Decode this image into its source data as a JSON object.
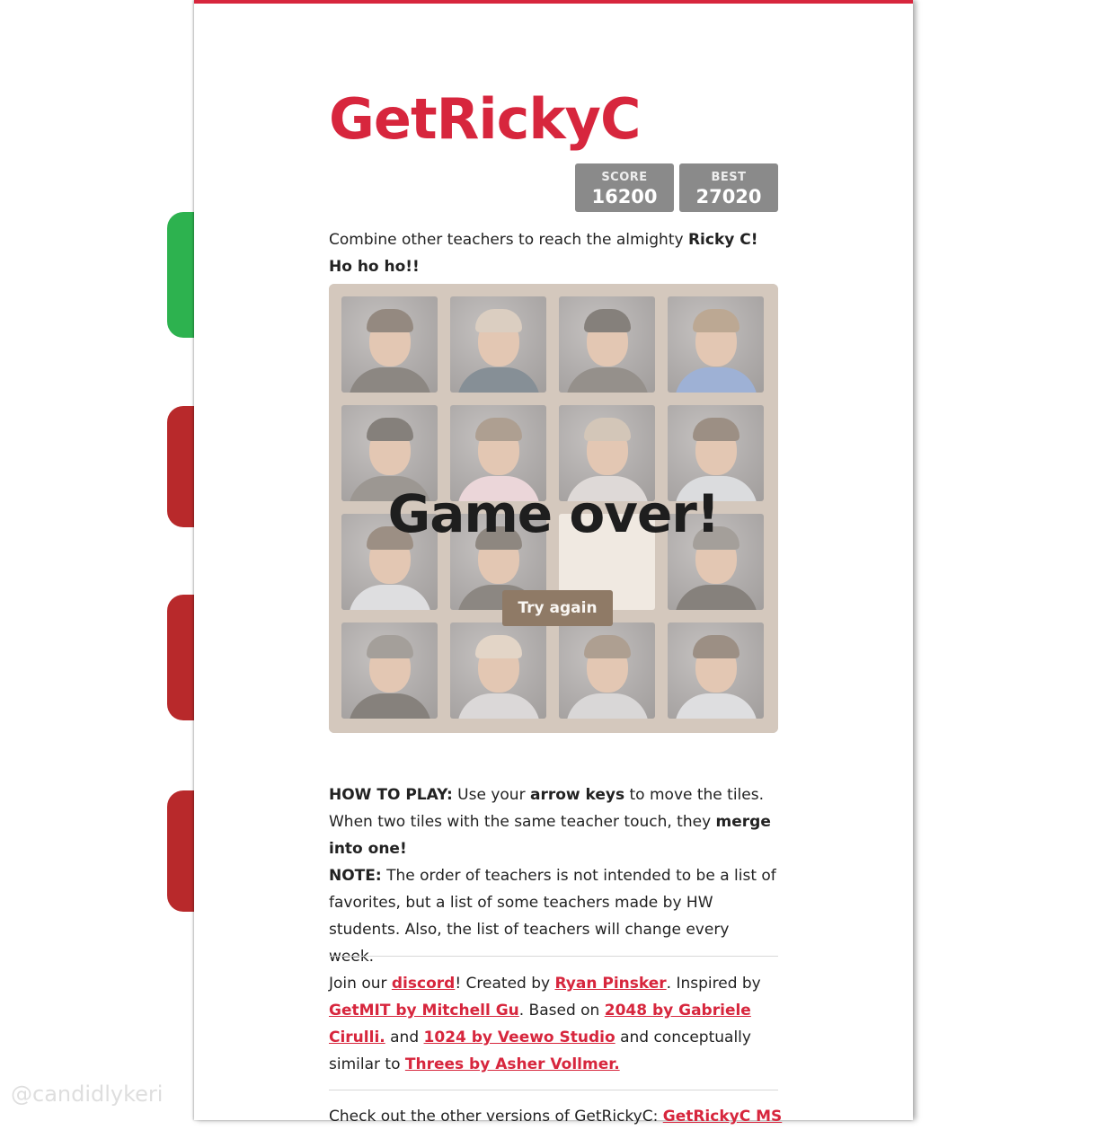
{
  "header": {
    "title": "GetRickyC"
  },
  "scores": {
    "score_label": "SCORE",
    "score_value": "16200",
    "best_label": "BEST",
    "best_value": "27020"
  },
  "intro": {
    "text": "Combine other teachers to reach the almighty ",
    "bold": "Ricky C! Ho ho ho!!"
  },
  "board": {
    "size": 4,
    "tiles": [
      "teacher",
      "teacher",
      "teacher",
      "teacher",
      "teacher",
      "teacher",
      "teacher",
      "teacher",
      "teacher",
      "teacher",
      "empty",
      "teacher",
      "teacher",
      "teacher",
      "teacher",
      "teacher"
    ],
    "game_over_message": "Game over!",
    "try_again_label": "Try again"
  },
  "howto": {
    "heading": "HOW TO PLAY:",
    "text1": " Use your ",
    "bold1": "arrow keys",
    "text2": " to move the tiles. When two tiles with the same teacher touch, they ",
    "bold2": "merge into one!",
    "note_heading": "NOTE:",
    "note_text": " The order of teachers is not intended to be a list of favorites, but a list of some teachers made by HW students. Also, the list of teachers will change every week."
  },
  "credits": {
    "t1": "Join our ",
    "discord": "discord",
    "t2": "! Created by ",
    "author": "Ryan Pinsker",
    "t3": ". Inspired by ",
    "getmit": "GetMIT by Mitchell Gu",
    "t4": ". Based on ",
    "g2048": "2048 by Gabriele Cirulli.",
    "t5": " and ",
    "g1024": "1024 by Veewo Studio",
    "t6": " and conceptually similar to ",
    "threes": "Threes by Asher Vollmer."
  },
  "more": {
    "text": "Check out the other versions of GetRickyC: ",
    "link": "GetRickyC MS"
  },
  "watermark": "@candidlykeri",
  "colors": {
    "accent": "#d7263d",
    "score_bg": "#8a8a8a",
    "board_bg": "#bbada0",
    "button_bg": "#8f7a66"
  }
}
